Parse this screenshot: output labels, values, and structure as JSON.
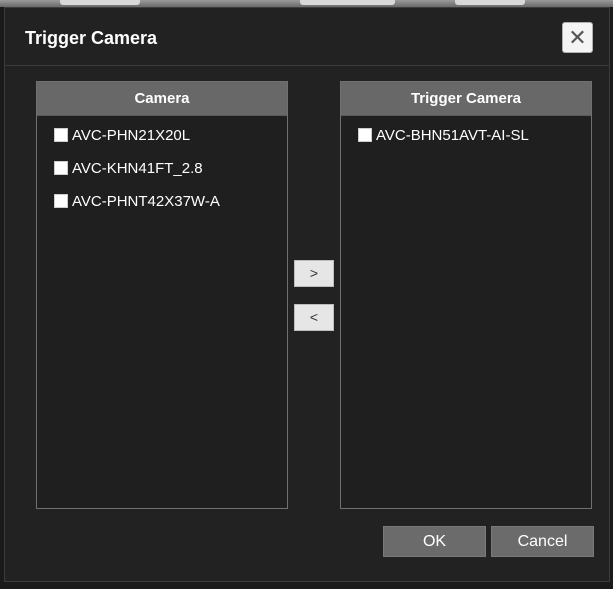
{
  "dialog": {
    "title": "Trigger Camera",
    "close_label": "✕"
  },
  "camera_panel": {
    "header": "Camera",
    "items": [
      {
        "label": "AVC-PHN21X20L",
        "checked": false
      },
      {
        "label": "AVC-KHN41FT_2.8",
        "checked": false
      },
      {
        "label": "AVC-PHNT42X37W-A",
        "checked": false
      }
    ]
  },
  "trigger_panel": {
    "header": "Trigger Camera",
    "items": [
      {
        "label": "AVC-BHN51AVT-AI-SL",
        "checked": false
      }
    ]
  },
  "buttons": {
    "add": ">",
    "remove": "<",
    "ok": "OK",
    "cancel": "Cancel"
  }
}
